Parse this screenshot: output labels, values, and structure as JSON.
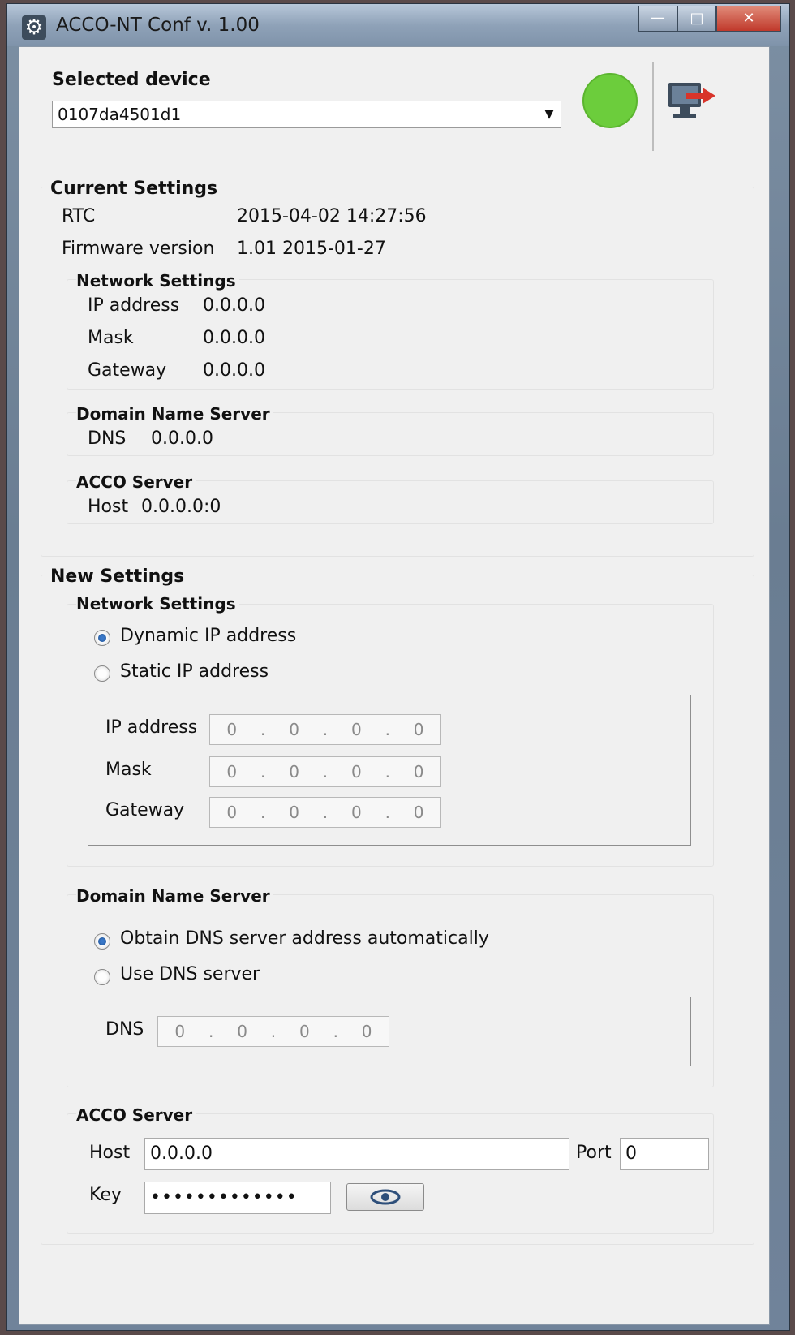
{
  "window": {
    "title": "ACCO-NT Conf v. 1.00",
    "minimize_label": "—",
    "maximize_label": "□",
    "close_label": "✕"
  },
  "device": {
    "label": "Selected device",
    "selected": "0107da4501d1",
    "status_color": "#6ccd3c"
  },
  "current": {
    "title": "Current Settings",
    "rtc_label": "RTC",
    "rtc_value": "2015-04-02 14:27:56",
    "fw_label": "Firmware version",
    "fw_value": "1.01 2015-01-27",
    "network": {
      "title": "Network Settings",
      "ip_label": "IP address",
      "ip_value": "0.0.0.0",
      "mask_label": "Mask",
      "mask_value": "0.0.0.0",
      "gateway_label": "Gateway",
      "gateway_value": "0.0.0.0"
    },
    "dns": {
      "title": "Domain Name Server",
      "dns_label": "DNS",
      "dns_value": "0.0.0.0"
    },
    "acco": {
      "title": "ACCO Server",
      "host_label": "Host",
      "host_value": "0.0.0.0:0"
    }
  },
  "new": {
    "title": "New Settings",
    "network": {
      "title": "Network Settings",
      "dynamic_label": "Dynamic IP address",
      "static_label": "Static IP address",
      "ip_label": "IP address",
      "mask_label": "Mask",
      "gateway_label": "Gateway",
      "ip_octets": [
        "0",
        ".",
        "0",
        ".",
        "0",
        ".",
        "0"
      ],
      "mask_octets": [
        "0",
        ".",
        "0",
        ".",
        "0",
        ".",
        "0"
      ],
      "gateway_octets": [
        "0",
        ".",
        "0",
        ".",
        "0",
        ".",
        "0"
      ]
    },
    "dns": {
      "title": "Domain Name Server",
      "auto_label": "Obtain DNS server address automatically",
      "use_label": "Use DNS server",
      "dns_label": "DNS",
      "dns_octets": [
        "0",
        ".",
        "0",
        ".",
        "0",
        ".",
        "0"
      ]
    },
    "acco": {
      "title": "ACCO Server",
      "host_label": "Host",
      "host_value": "0.0.0.0",
      "port_label": "Port",
      "port_value": "0",
      "key_label": "Key",
      "key_value": "•••••••••••••"
    }
  }
}
